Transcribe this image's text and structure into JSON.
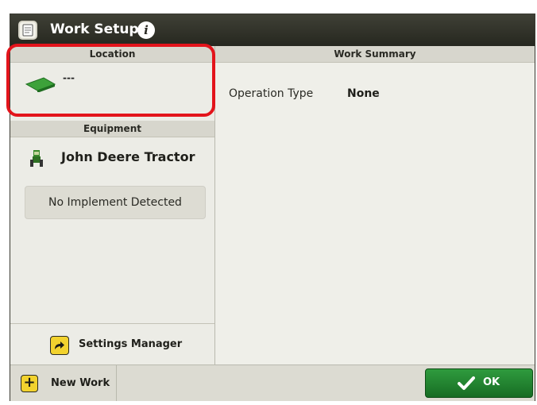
{
  "window": {
    "title": "Work Setup",
    "icon": "clipboard-icon",
    "info_icon": "info-icon"
  },
  "location": {
    "header": "Location",
    "value": "---",
    "icon": "field-icon"
  },
  "equipment": {
    "header": "Equipment",
    "tractor_name": "John Deere Tractor",
    "tractor_icon": "tractor-icon",
    "implement_status": "No Implement Detected"
  },
  "settings_manager": {
    "label": "Settings Manager",
    "icon": "arrow-forward-icon"
  },
  "work_summary": {
    "header": "Work Summary",
    "rows": [
      {
        "label": "Operation Type",
        "value": "None"
      }
    ]
  },
  "footer": {
    "new_work_label": "New Work",
    "new_work_icon": "plus-icon",
    "ok_label": "OK",
    "ok_icon": "checkmark-icon"
  },
  "colors": {
    "titlebar": "#2f3028",
    "accent_green": "#1f7f2d",
    "accent_yellow": "#f2d22e",
    "highlight_red": "#e3141b"
  }
}
